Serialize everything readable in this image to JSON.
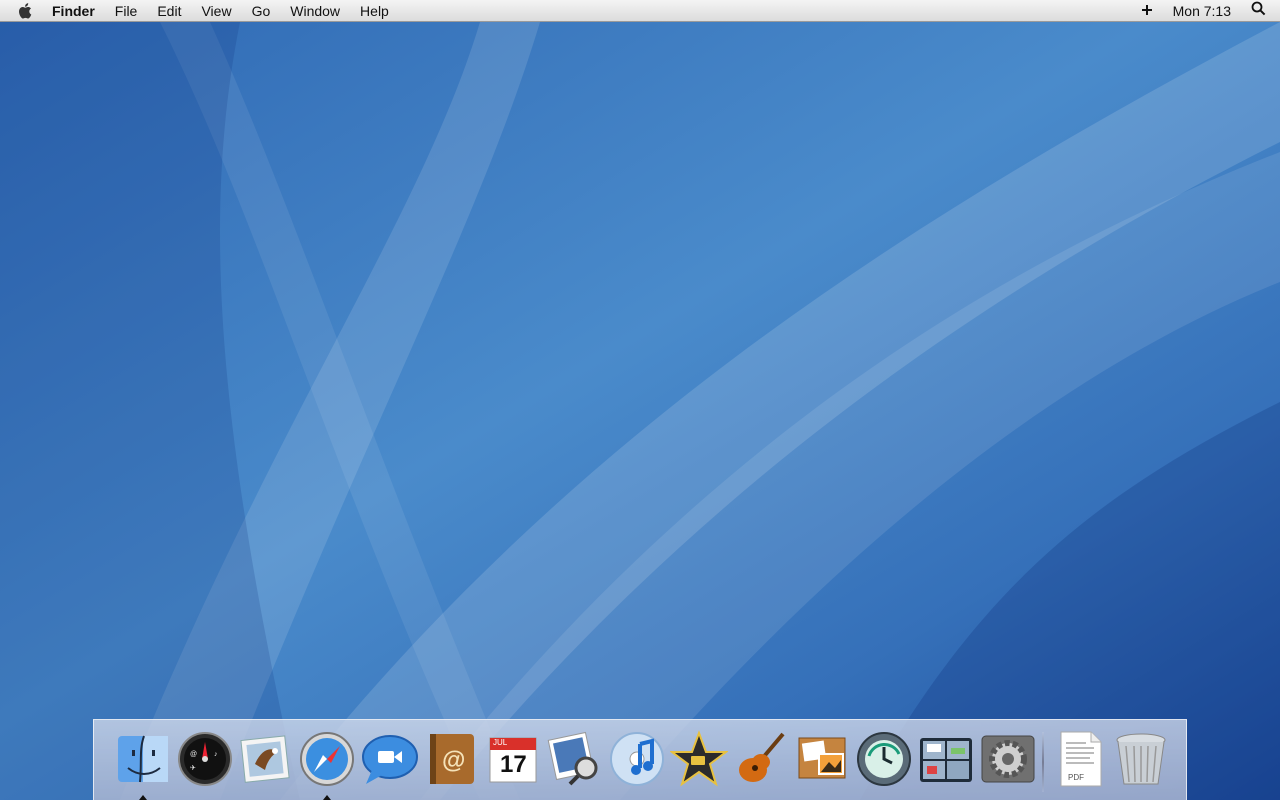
{
  "menubar": {
    "apple_icon": "apple-logo-icon",
    "app_name": "Finder",
    "menus": [
      "File",
      "Edit",
      "View",
      "Go",
      "Window",
      "Help"
    ],
    "status": {
      "bluetooth_icon": "plus-icon",
      "clock": "Mon 7:13",
      "spotlight_icon": "spotlight-search-icon"
    }
  },
  "dock": {
    "apps": [
      {
        "name": "Finder",
        "icon": "finder-icon",
        "running": true
      },
      {
        "name": "Dashboard",
        "icon": "dashboard-icon",
        "running": false
      },
      {
        "name": "Mail",
        "icon": "mail-icon",
        "running": false
      },
      {
        "name": "Safari",
        "icon": "safari-icon",
        "running": true
      },
      {
        "name": "iChat",
        "icon": "ichat-icon",
        "running": false
      },
      {
        "name": "Address Book",
        "icon": "address-book-icon",
        "running": false
      },
      {
        "name": "iCal",
        "icon": "ical-icon",
        "running": false
      },
      {
        "name": "Preview",
        "icon": "preview-icon",
        "running": false
      },
      {
        "name": "iTunes",
        "icon": "itunes-icon",
        "running": false
      },
      {
        "name": "iMovie",
        "icon": "imovie-icon",
        "running": false
      },
      {
        "name": "GarageBand",
        "icon": "garageband-icon",
        "running": false
      },
      {
        "name": "iPhoto",
        "icon": "iphoto-icon",
        "running": false
      },
      {
        "name": "Time Machine",
        "icon": "time-machine-icon",
        "running": false
      },
      {
        "name": "Spaces",
        "icon": "spaces-icon",
        "running": false
      },
      {
        "name": "System Preferences",
        "icon": "system-preferences-icon",
        "running": false
      }
    ],
    "docs": [
      {
        "name": "PDF document",
        "icon": "pdf-document-icon",
        "label": "PDF"
      },
      {
        "name": "Trash",
        "icon": "trash-icon"
      }
    ],
    "ical_month": "JUL",
    "ical_day": "17"
  }
}
